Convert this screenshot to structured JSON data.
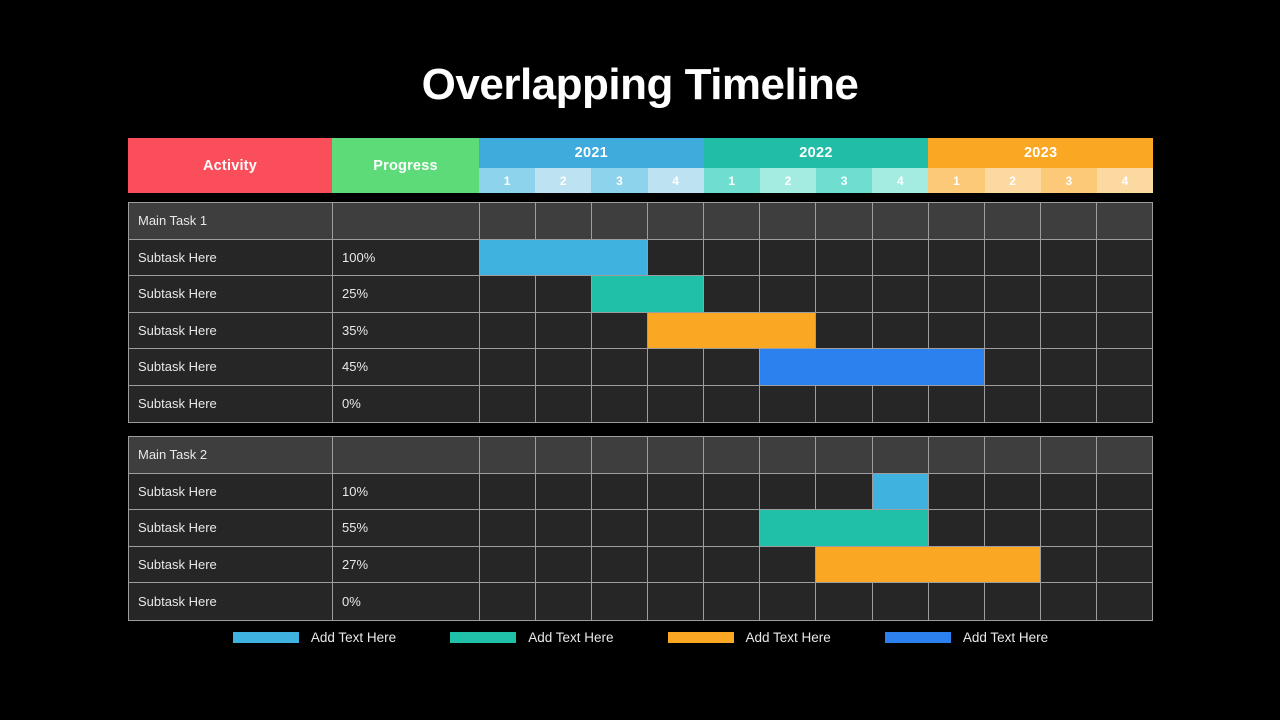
{
  "title": "Overlapping Timeline",
  "header": {
    "activity_label": "Activity",
    "progress_label": "Progress",
    "years": [
      {
        "label": "2021",
        "color": "#3fabdd",
        "quarters": [
          "1",
          "2",
          "3",
          "4"
        ],
        "quarter_colors": [
          "#8ed3ec",
          "#bde2f2",
          "#8ed3ec",
          "#bde2f2"
        ]
      },
      {
        "label": "2022",
        "color": "#22bda6",
        "quarters": [
          "1",
          "2",
          "3",
          "4"
        ],
        "quarter_colors": [
          "#6fded0",
          "#a4ebe2",
          "#6fded0",
          "#a4ebe2"
        ]
      },
      {
        "label": "2023",
        "color": "#faa823",
        "quarters": [
          "1",
          "2",
          "3",
          "4"
        ],
        "quarter_colors": [
          "#fbc978",
          "#fcd9a1",
          "#fbc978",
          "#fcd9a1"
        ]
      }
    ]
  },
  "colors": {
    "activity_header": "#fa4e5a",
    "progress_header": "#5edb79",
    "light_blue": "#3fb2e0",
    "teal": "#1fbfa8",
    "orange": "#faa823",
    "blue": "#2c81ee",
    "main_row_bg": "#3e3e3e",
    "sub_row_bg": "#262626",
    "grid_line": "#9d9d9d",
    "background": "#000000"
  },
  "chart_data": {
    "type": "table",
    "title": "Overlapping Timeline",
    "columns": [
      "Activity",
      "Progress",
      "2021 Q1",
      "2021 Q2",
      "2021 Q3",
      "2021 Q4",
      "2022 Q1",
      "2022 Q2",
      "2022 Q3",
      "2022 Q4",
      "2023 Q1",
      "2023 Q2",
      "2023 Q3",
      "2023 Q4"
    ],
    "total_quarters": 12,
    "blocks": [
      {
        "name": "Main Task 1",
        "rows": [
          {
            "activity": "Main Task 1",
            "progress": "",
            "is_main": true,
            "bar": null
          },
          {
            "activity": "Subtask Here",
            "progress": "100%",
            "is_main": false,
            "bar": {
              "start": 1,
              "span": 3,
              "color": "#3fb2e0"
            }
          },
          {
            "activity": "Subtask Here",
            "progress": "25%",
            "is_main": false,
            "bar": {
              "start": 3,
              "span": 2,
              "color": "#1fbfa8"
            }
          },
          {
            "activity": "Subtask Here",
            "progress": "35%",
            "is_main": false,
            "bar": {
              "start": 4,
              "span": 3,
              "color": "#faa823"
            }
          },
          {
            "activity": "Subtask Here",
            "progress": "45%",
            "is_main": false,
            "bar": {
              "start": 6,
              "span": 4,
              "color": "#2c81ee"
            }
          },
          {
            "activity": "Subtask Here",
            "progress": "0%",
            "is_main": false,
            "bar": null
          }
        ]
      },
      {
        "name": "Main Task 2",
        "rows": [
          {
            "activity": "Main Task 2",
            "progress": "",
            "is_main": true,
            "bar": null
          },
          {
            "activity": "Subtask Here",
            "progress": "10%",
            "is_main": false,
            "bar": {
              "start": 8,
              "span": 1,
              "color": "#3fb2e0"
            }
          },
          {
            "activity": "Subtask Here",
            "progress": "55%",
            "is_main": false,
            "bar": {
              "start": 6,
              "span": 3,
              "color": "#1fbfa8"
            }
          },
          {
            "activity": "Subtask Here",
            "progress": "27%",
            "is_main": false,
            "bar": {
              "start": 7,
              "span": 4,
              "color": "#faa823"
            }
          },
          {
            "activity": "Subtask Here",
            "progress": "0%",
            "is_main": false,
            "bar": null
          }
        ]
      }
    ]
  },
  "legend": [
    {
      "color": "#3fb2e0",
      "label": "Add Text Here"
    },
    {
      "color": "#1fbfa8",
      "label": "Add Text Here"
    },
    {
      "color": "#faa823",
      "label": "Add Text Here"
    },
    {
      "color": "#2c81ee",
      "label": "Add Text Here"
    }
  ]
}
